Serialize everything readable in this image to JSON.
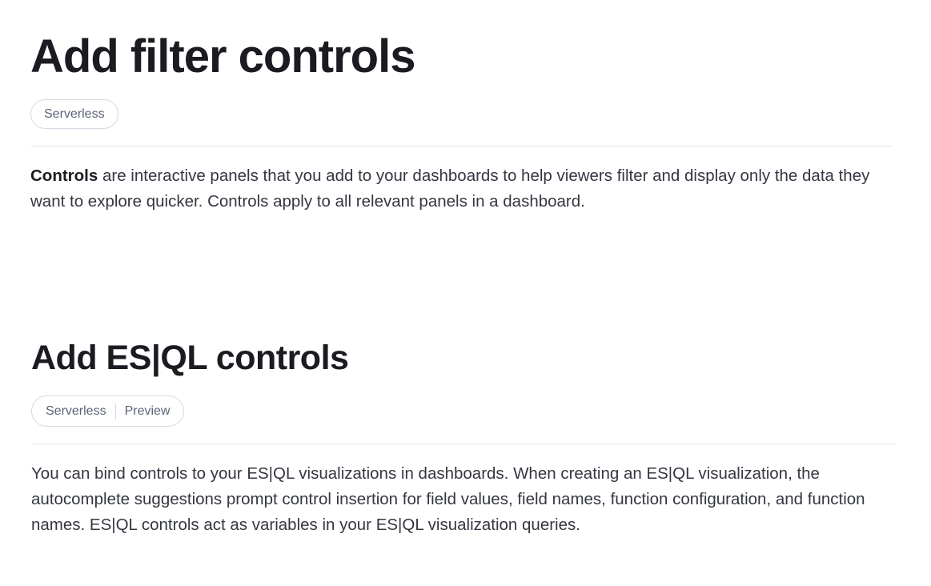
{
  "section_filter": {
    "title": "Add filter controls",
    "badges": [
      "Serverless"
    ],
    "body_strong": "Controls",
    "body_rest": " are interactive panels that you add to your dashboards to help viewers filter and display only the data they want to explore quicker. Controls apply to all relevant panels in a dashboard."
  },
  "section_esql": {
    "title": "Add ES|QL controls",
    "badges": [
      "Serverless",
      "Preview"
    ],
    "body": "You can bind controls to your ES|QL visualizations in dashboards. When creating an ES|QL visualization, the autocomplete suggestions prompt control insertion for field values, field names, function configuration, and function names. ES|QL controls act as variables in your ES|QL visualization queries."
  }
}
